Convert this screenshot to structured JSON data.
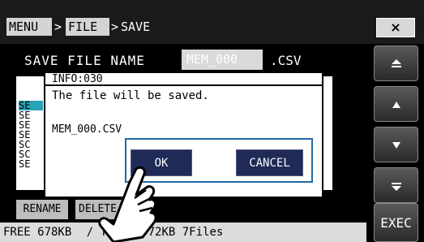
{
  "titlebar": {
    "menu_label": "MENU",
    "file_label": "FILE",
    "sep1": ">",
    "sep2": ">",
    "current": "SAVE",
    "close_label": "×"
  },
  "form": {
    "save_file_name_label": "SAVE FILE NAME",
    "filename_value": "MEM_000",
    "extension": ".CSV"
  },
  "file_list": {
    "rows": [
      "SE",
      "SE",
      "SE",
      "SE",
      "SC",
      "SC",
      "SE"
    ]
  },
  "side_buttons": [
    {
      "name": "scroll-top-button",
      "icon": "double-up-arrow-icon",
      "label": "▲"
    },
    {
      "name": "scroll-up-button",
      "icon": "up-arrow-icon",
      "label": "▲"
    },
    {
      "name": "scroll-down-button",
      "icon": "down-arrow-icon",
      "label": "▼"
    },
    {
      "name": "scroll-bottom-button",
      "icon": "double-down-arrow-icon",
      "label": "▼"
    }
  ],
  "exec_label": "EXEC",
  "rename_label": "RENAME",
  "delete_label": "DELETE",
  "status": {
    "free": "FREE 678KB",
    "total": "/ TOTAL 972KB 7Files"
  },
  "dialog": {
    "header": "INFO:030",
    "message": "The file will be saved.",
    "filename": "MEM_000.CSV",
    "ok_label": "OK",
    "cancel_label": "CANCEL"
  },
  "colors": {
    "selected_row": "#2aa3b8",
    "dialog_button": "#1f2a56",
    "dialog_button_frame": "#1f6aa8"
  }
}
